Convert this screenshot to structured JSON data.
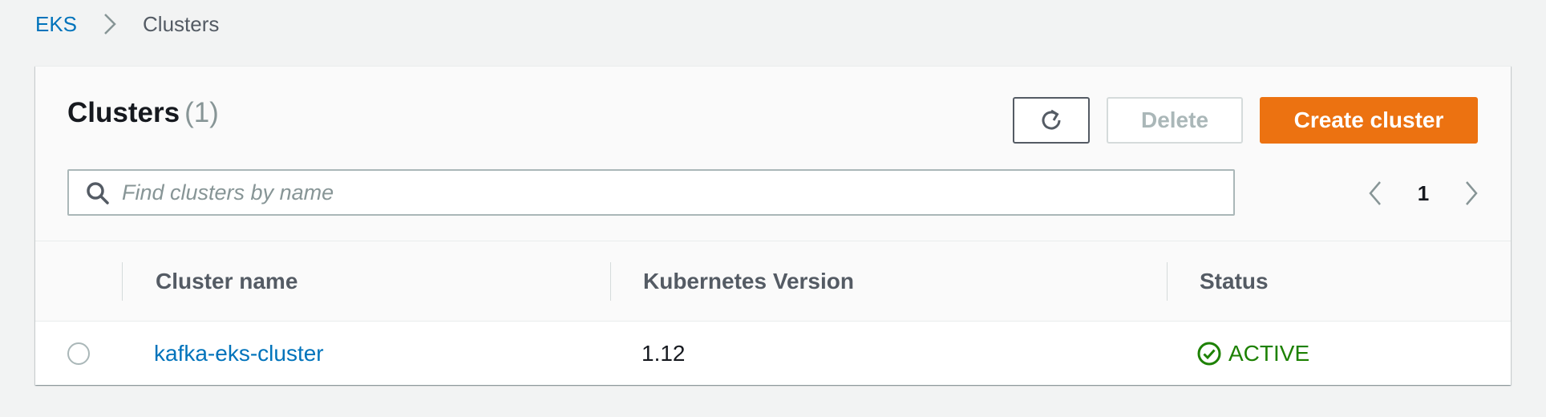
{
  "breadcrumb": {
    "root": "EKS",
    "current": "Clusters"
  },
  "panel": {
    "title": "Clusters",
    "count": "(1)",
    "buttons": {
      "delete": "Delete",
      "create": "Create cluster"
    },
    "search": {
      "placeholder": "Find clusters by name",
      "value": ""
    },
    "pagination": {
      "current_page": "1"
    }
  },
  "table": {
    "columns": [
      "Cluster name",
      "Kubernetes Version",
      "Status"
    ],
    "rows": [
      {
        "name": "kafka-eks-cluster",
        "version": "1.12",
        "status": "ACTIVE"
      }
    ]
  },
  "colors": {
    "accent_orange": "#ec7211",
    "link_blue": "#0073bb",
    "status_green": "#1d8102"
  },
  "icons": {
    "breadcrumb_separator": "chevron-right-icon",
    "refresh": "refresh-icon",
    "search": "search-icon",
    "prev": "chevron-left-icon",
    "next": "chevron-right-icon",
    "status": "check-circle-icon"
  }
}
